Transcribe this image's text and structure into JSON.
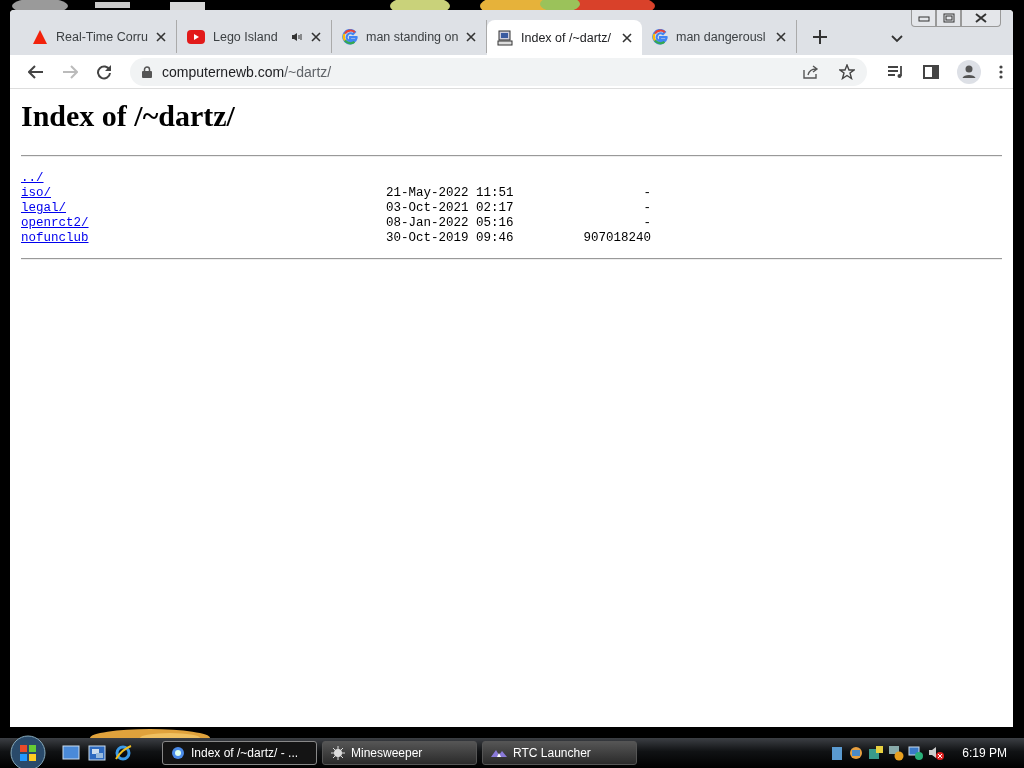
{
  "tabs": [
    {
      "label": "Real-Time Corru",
      "kind": "triangle",
      "audio": false,
      "selected": false
    },
    {
      "label": "Lego Island",
      "kind": "video",
      "audio": true,
      "selected": false
    },
    {
      "label": "man standing on",
      "kind": "google",
      "audio": false,
      "selected": false
    },
    {
      "label": "Index of /~dartz/",
      "kind": "computer",
      "audio": false,
      "selected": true
    },
    {
      "label": "man dangerousl",
      "kind": "google",
      "audio": false,
      "selected": false
    }
  ],
  "address": {
    "host": "computernewb.com",
    "path": "/~dartz/"
  },
  "page": {
    "title": "Index of /~dartz/",
    "entries": [
      {
        "name": "../"
      },
      {
        "name": "iso/",
        "date": "21-May-2022 11:51",
        "size": "-"
      },
      {
        "name": "legal/",
        "date": "03-Oct-2021 02:17",
        "size": "-"
      },
      {
        "name": "openrct2/",
        "date": "08-Jan-2022 05:16",
        "size": "-"
      },
      {
        "name": "nofunclub",
        "date": "30-Oct-2019 09:46",
        "size": "907018240"
      }
    ]
  },
  "taskbar": {
    "buttons": [
      {
        "label": "Index of /~dartz/ - ...",
        "kind": "browser",
        "selected": true
      },
      {
        "label": "Minesweeper",
        "kind": "mine",
        "selected": false
      },
      {
        "label": "RTC Launcher",
        "kind": "launcher",
        "selected": false
      }
    ],
    "clock": "6:19 PM"
  }
}
